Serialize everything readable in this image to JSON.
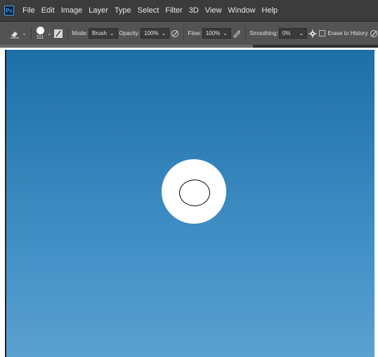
{
  "app": {
    "logo_text": "Ps"
  },
  "menu": [
    "File",
    "Edit",
    "Image",
    "Layer",
    "Type",
    "Select",
    "Filter",
    "3D",
    "View",
    "Window",
    "Help"
  ],
  "options": {
    "brush_size": "111",
    "mode_label": "Mode:",
    "mode_value": "Brush",
    "opacity_label": "Opacity:",
    "opacity_value": "100%",
    "flow_label": "Flow:",
    "flow_value": "100%",
    "smoothing_label": "Smoothing:",
    "smoothing_value": "0%",
    "erase_history_label": "Erase to History",
    "erase_history_checked": false
  },
  "icons": {
    "eraser": "eraser-icon",
    "brush_preset": "brush-preset-icon",
    "brush_panel": "brush-settings-panel-icon",
    "opacity_pressure": "pressure-opacity-icon",
    "airbrush": "airbrush-icon",
    "smoothing_gear": "gear-icon",
    "pressure_size": "pressure-size-icon"
  },
  "colors": {
    "menubar_bg": "#3c3c3c",
    "optionsbar_bg": "#535353",
    "canvas_top": "#1e6ea7",
    "canvas_bottom": "#5aa1d0",
    "brush_color": "#ffffff"
  }
}
